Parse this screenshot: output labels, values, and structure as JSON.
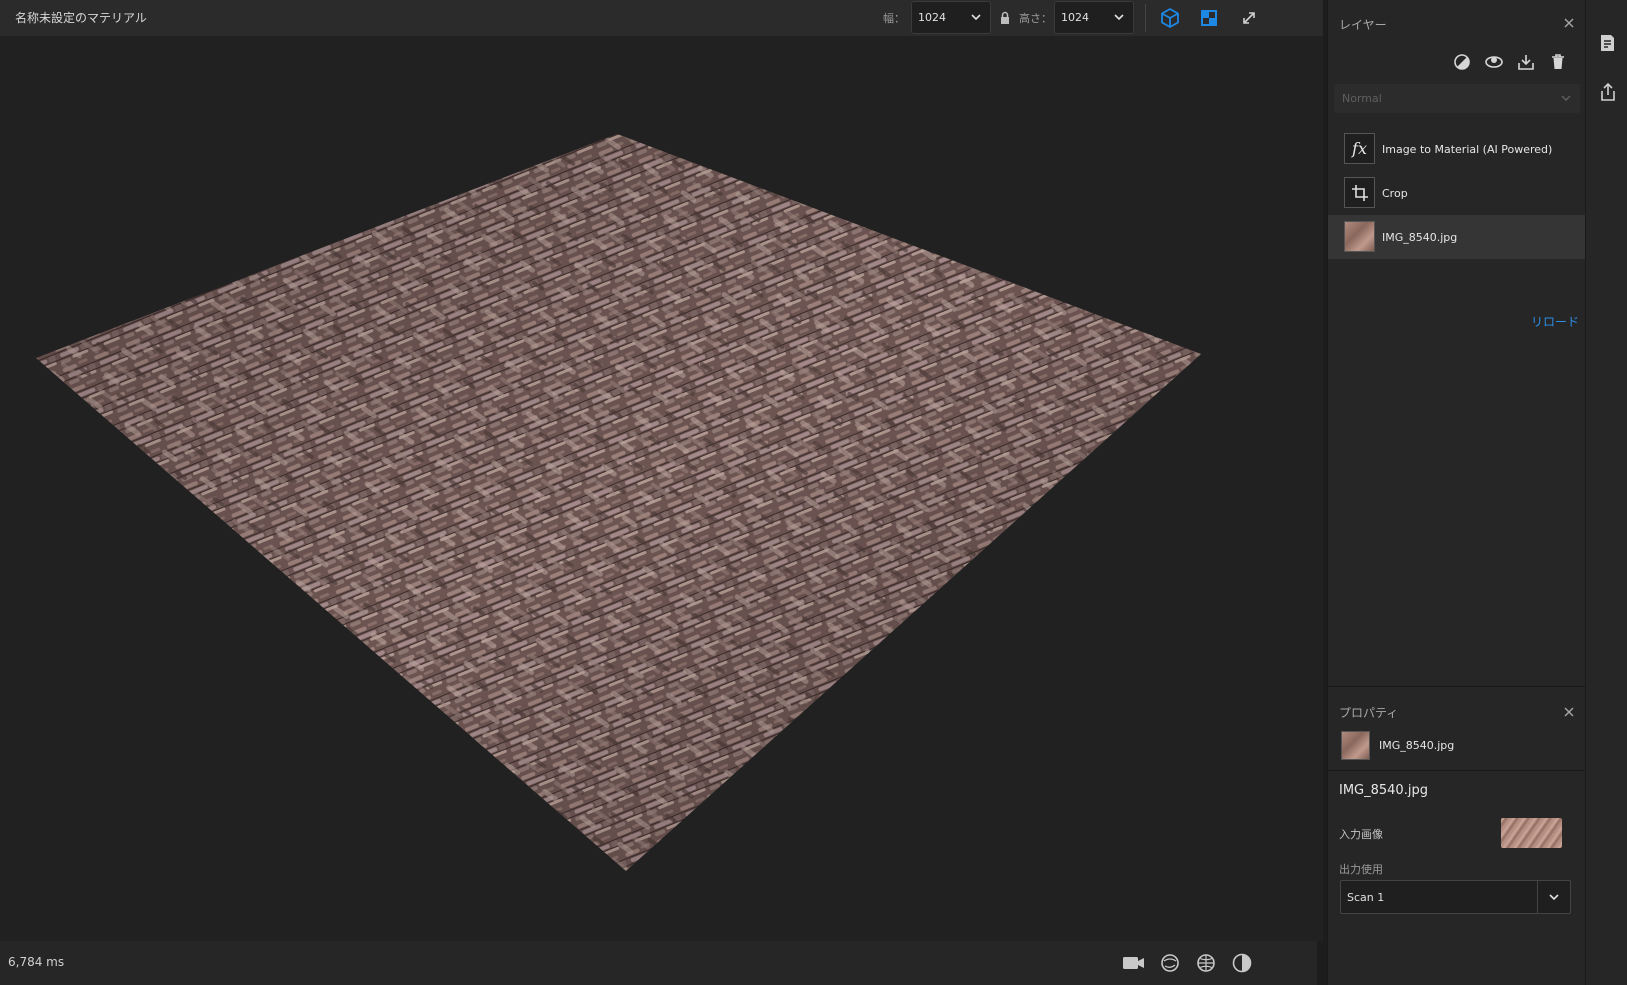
{
  "header": {
    "title": "名称未設定のマテリアル",
    "width_label": "幅：",
    "width_value": "1024",
    "height_label": "高さ：",
    "height_value": "1024"
  },
  "layers": {
    "title": "レイヤー",
    "blend_mode": "Normal",
    "items": [
      {
        "label": "Image to Material (AI Powered)",
        "icon": "fx-icon"
      },
      {
        "label": "Crop",
        "icon": "crop-icon"
      },
      {
        "label": "IMG_8540.jpg",
        "icon": "image-thumbnail",
        "selected": true
      }
    ],
    "reload_label": "リロード"
  },
  "properties": {
    "title": "プロパティ",
    "layer_name": "IMG_8540.jpg",
    "file_name": "IMG_8540.jpg",
    "input_image_label": "入力画像",
    "output_label": "出力使用",
    "output_value": "Scan 1"
  },
  "status": {
    "time": "6,784 ms"
  },
  "colors": {
    "accent": "#1e88e5",
    "link": "#2e8ee6",
    "panel_bg": "#262626",
    "viewport_bg": "#212121"
  }
}
